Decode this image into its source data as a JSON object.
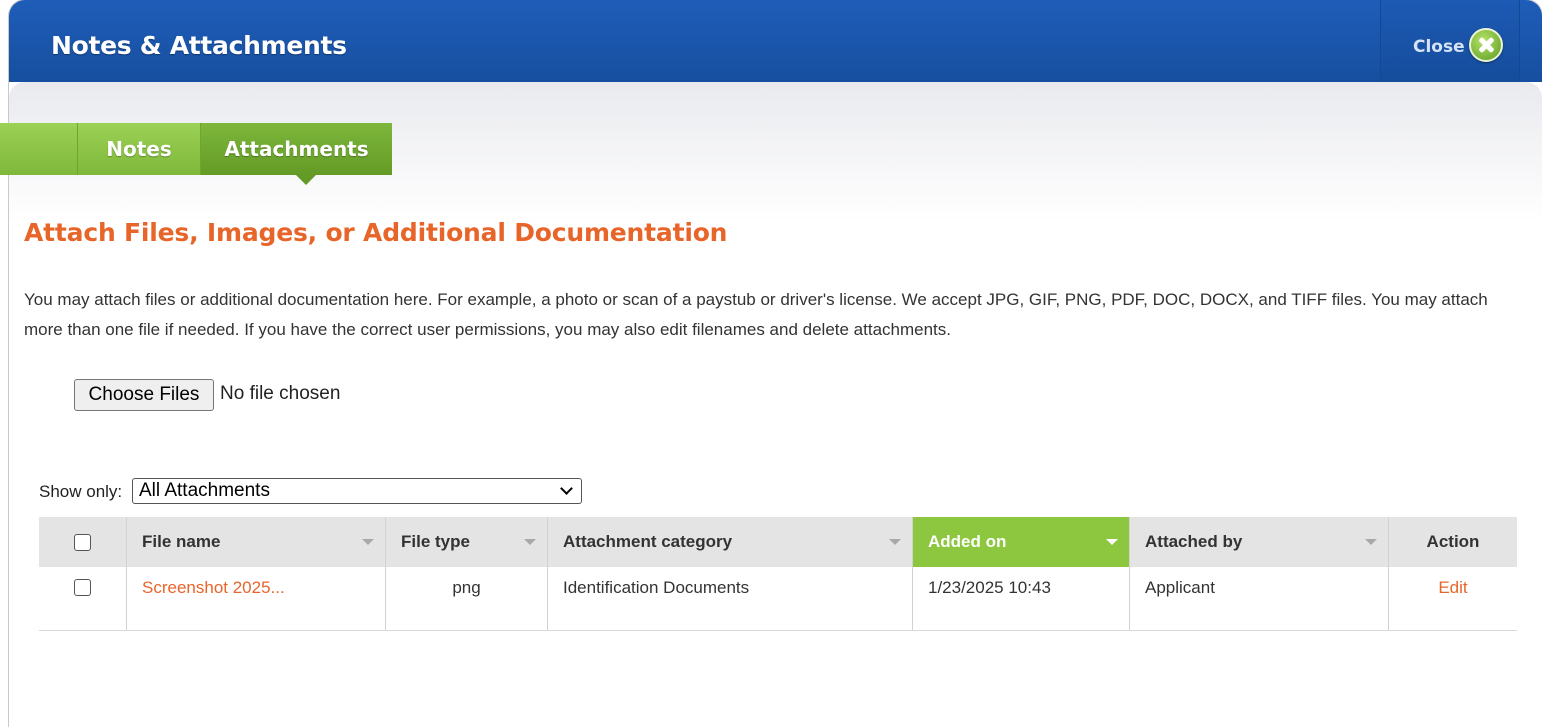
{
  "dialog": {
    "title": "Notes & Attachments",
    "close_label": "Close",
    "close_icon": "green-circle-x-icon"
  },
  "tabs": [
    {
      "label": "Notes",
      "active": false
    },
    {
      "label": "Attachments",
      "active": true
    }
  ],
  "content": {
    "heading": "Attach Files, Images, or Additional Documentation",
    "description": "You may attach files or additional documentation here. For example, a photo or scan of a paystub or driver's license. We accept JPG, GIF, PNG, PDF, DOC, DOCX, and TIFF files. You may attach more than one file if needed. If you have the correct user permissions, you may also edit filenames and delete attachments."
  },
  "file_input": {
    "button_label": "Choose Files",
    "status": "No file chosen"
  },
  "filter": {
    "label": "Show only:",
    "selected": "All Attachments"
  },
  "table": {
    "columns": [
      {
        "label": "",
        "sortable": false
      },
      {
        "label": "File name",
        "sortable": true
      },
      {
        "label": "File type",
        "sortable": true
      },
      {
        "label": "Attachment category",
        "sortable": true
      },
      {
        "label": "Added on",
        "sortable": true,
        "sorted": true
      },
      {
        "label": "Attached by",
        "sortable": true
      },
      {
        "label": "Action",
        "sortable": false
      }
    ],
    "rows": [
      {
        "checked": false,
        "file_name": "Screenshot 2025...",
        "file_type": "png",
        "category": "Identification Documents",
        "added_on": "1/23/2025 10:43",
        "attached_by": "Applicant",
        "action": "Edit"
      }
    ]
  },
  "colors": {
    "header_blue": "#1f5db9",
    "tab_green": "#8dc63f",
    "accent_orange": "#e8652a"
  }
}
